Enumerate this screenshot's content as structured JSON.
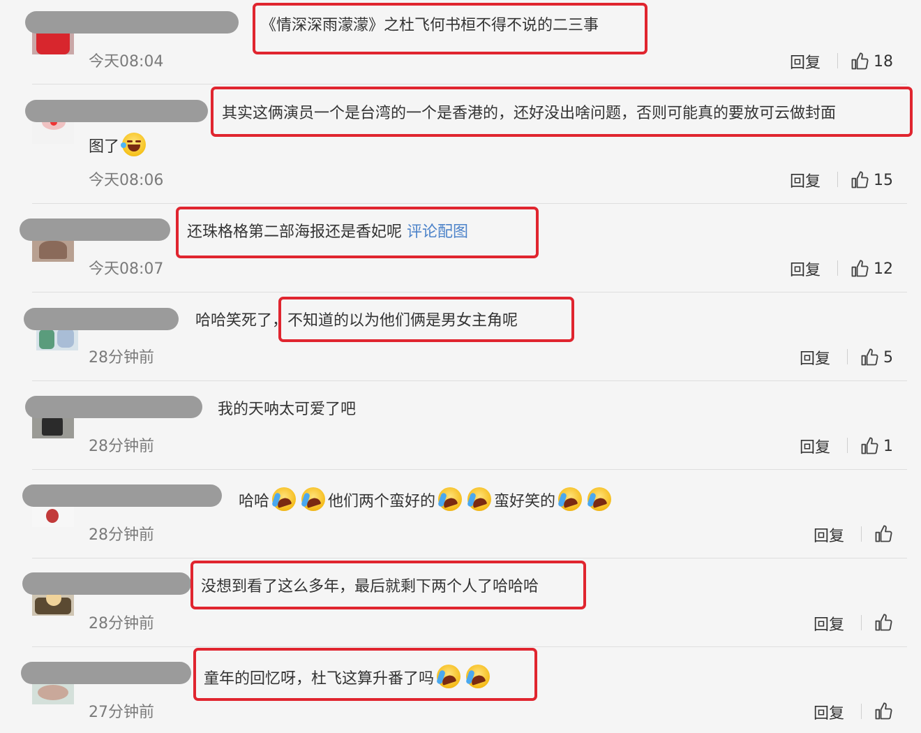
{
  "reply_label": "回复",
  "colors": {
    "highlight_box": "#e0252f",
    "link": "#4d83c9",
    "divider": "#dedede"
  },
  "comments": [
    {
      "text": "《情深深雨濛濛》之杜飞何书桓不得不说的二三事",
      "time": "今天08:04",
      "likes": "18"
    },
    {
      "text": "其实这俩演员一个是台湾的一个是香港的，还好没出啥问题，否则可能真的要放可云做封面",
      "text2": "图了",
      "time": "今天08:06",
      "likes": "15"
    },
    {
      "text": "还珠格格第二部海报还是香妃呢",
      "link": "评论配图",
      "time": "今天08:07",
      "likes": "12"
    },
    {
      "text": "哈哈笑死了，不知道的以为他们俩是男女主角呢",
      "time": "28分钟前",
      "likes": "5"
    },
    {
      "text": "我的天呐太可爱了吧",
      "time": "28分钟前",
      "likes": "1"
    },
    {
      "text_a": "哈哈",
      "text_b": "他们两个蛮好的",
      "text_c": "蛮好笑的",
      "time": "28分钟前",
      "likes": ""
    },
    {
      "text": "没想到看了这么多年，最后就剩下两个人了哈哈哈",
      "time": "28分钟前",
      "likes": ""
    },
    {
      "text": "童年的回忆呀，杜飞这算升番了吗",
      "time": "27分钟前",
      "likes": ""
    }
  ]
}
